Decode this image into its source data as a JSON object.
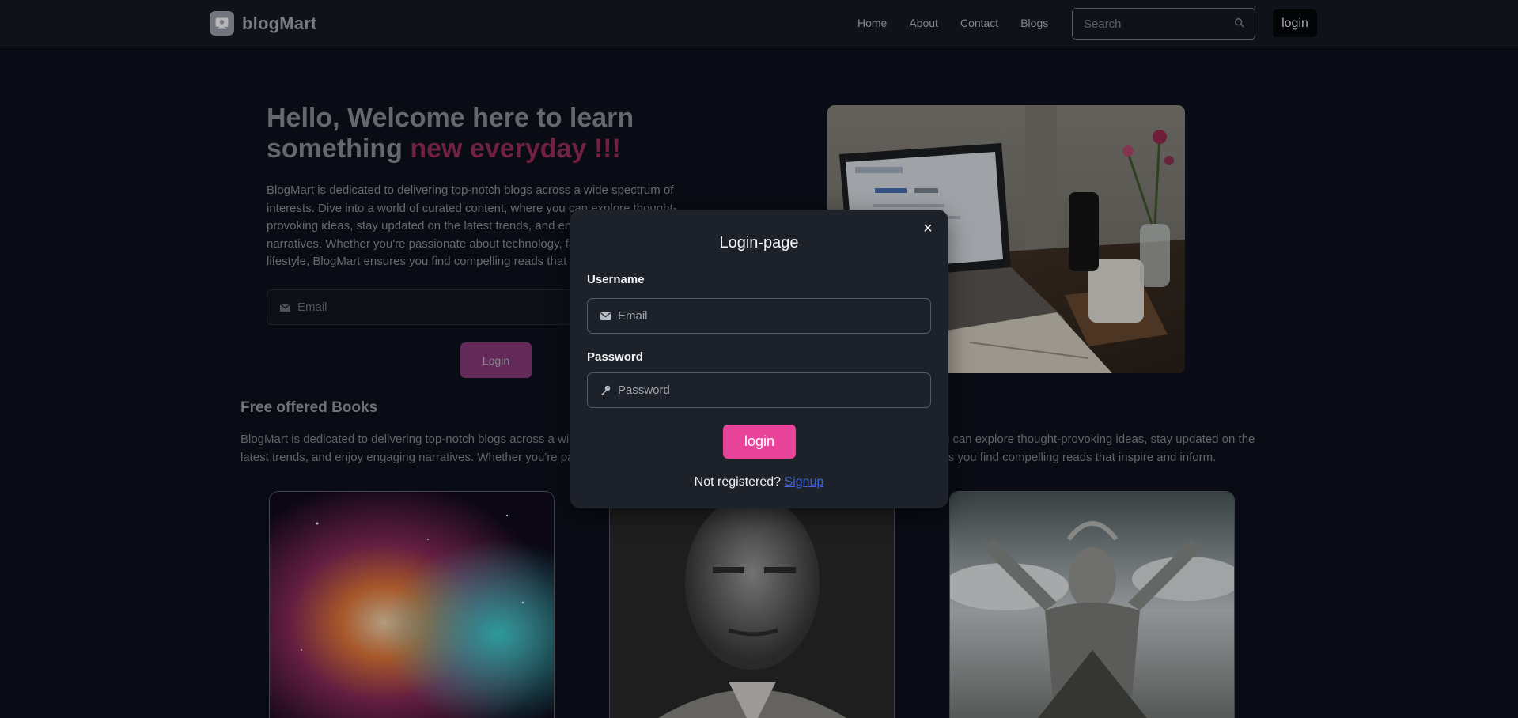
{
  "navbar": {
    "brand": "blogMart",
    "links": [
      "Home",
      "About",
      "Contact",
      "Blogs"
    ],
    "search_placeholder": "Search",
    "login_label": "login"
  },
  "hero": {
    "title_part1": "Hello, Welcome here to learn something ",
    "title_accent": "new everyday !!!",
    "description": "BlogMart is dedicated to delivering top-notch blogs across a wide spectrum of interests. Dive into a world of curated content, where you can explore thought-provoking ideas, stay updated on the latest trends, and enjoy engaging narratives. Whether you're passionate about technology, fashion, health, or lifestyle, BlogMart ensures you find compelling reads that inspire and inform.",
    "email_placeholder": "Email",
    "login_label": "Login"
  },
  "books": {
    "title": "Free offered Books",
    "description": "BlogMart is dedicated to delivering top-notch blogs across a wide spectrum of interests. Dive into a world of curated content, where you can explore thought-provoking ideas, stay updated on the latest trends, and enjoy engaging narratives. Whether you're passionate about technology, fashion, health, or lifestyle, BlogMart ensures you find compelling reads that inspire and inform."
  },
  "modal": {
    "title": "Login-page",
    "close_icon": "×",
    "username_label": "Username",
    "username_placeholder": "Email",
    "password_label": "Password",
    "password_placeholder": "Password",
    "login_label": "login",
    "not_registered": "Not registered?",
    "signup_label": "Signup"
  },
  "colors": {
    "accent": "#9c2d5c",
    "modal_button": "#e8449a",
    "link": "#3a63d6"
  },
  "icons": [
    "blog-logo-icon",
    "search-icon",
    "envelope-icon",
    "key-icon",
    "close-icon"
  ]
}
